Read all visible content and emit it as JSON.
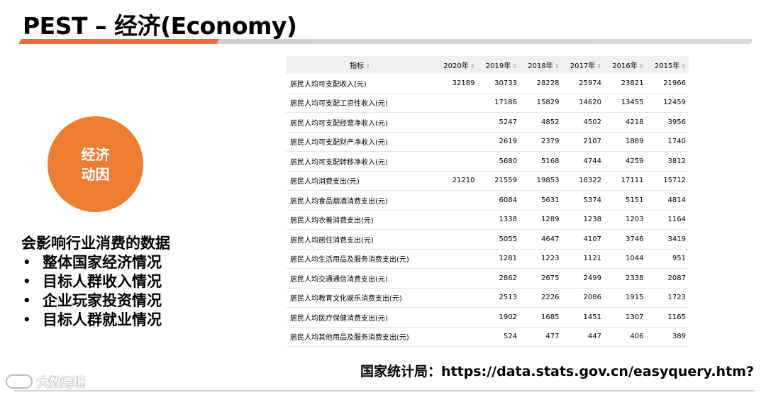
{
  "slide": {
    "title": "PEST – 经济(Economy)"
  },
  "circle": {
    "line1": "经济",
    "line2": "动因"
  },
  "factors": {
    "heading": "会影响行业消费的数据",
    "items": [
      "整体国家经济情况",
      "目标人群收入情况",
      "企业玩家投资情况",
      "目标人群就业情况"
    ]
  },
  "table": {
    "headers": [
      "指标",
      "2020年",
      "2019年",
      "2018年",
      "2017年",
      "2016年",
      "2015年"
    ],
    "sort_icon": "⇕",
    "rows": [
      [
        "居民人均可支配收入(元)",
        "32189",
        "30733",
        "28228",
        "25974",
        "23821",
        "21966"
      ],
      [
        "居民人均可支配工资性收入(元)",
        "",
        "17186",
        "15829",
        "14620",
        "13455",
        "12459"
      ],
      [
        "居民人均可支配经营净收入(元)",
        "",
        "5247",
        "4852",
        "4502",
        "4218",
        "3956"
      ],
      [
        "居民人均可支配财产净收入(元)",
        "",
        "2619",
        "2379",
        "2107",
        "1889",
        "1740"
      ],
      [
        "居民人均可支配转移净收入(元)",
        "",
        "5680",
        "5168",
        "4744",
        "4259",
        "3812"
      ],
      [
        "居民人均消费支出(元)",
        "21210",
        "21559",
        "19853",
        "18322",
        "17111",
        "15712"
      ],
      [
        "居民人均食品烟酒消费支出(元)",
        "",
        "6084",
        "5631",
        "5374",
        "5151",
        "4814"
      ],
      [
        "居民人均衣着消费支出(元)",
        "",
        "1338",
        "1289",
        "1238",
        "1203",
        "1164"
      ],
      [
        "居民人均居住消费支出(元)",
        "",
        "5055",
        "4647",
        "4107",
        "3746",
        "3419"
      ],
      [
        "居民人均生活用品及服务消费支出(元)",
        "",
        "1281",
        "1223",
        "1121",
        "1044",
        "951"
      ],
      [
        "居民人均交通通信消费支出(元)",
        "",
        "2862",
        "2675",
        "2499",
        "2338",
        "2087"
      ],
      [
        "居民人均教育文化娱乐消费支出(元)",
        "",
        "2513",
        "2226",
        "2086",
        "1915",
        "1723"
      ],
      [
        "居民人均医疗保健消费支出(元)",
        "",
        "1902",
        "1685",
        "1451",
        "1307",
        "1165"
      ],
      [
        "居民人均其他用品及服务消费支出(元)",
        "",
        "524",
        "477",
        "447",
        "406",
        "389"
      ]
    ]
  },
  "source": {
    "label": "国家统计局：",
    "url": "https://data.stats.gov.cn/easyquery.htm?"
  },
  "watermark": {
    "text": "大数跨境"
  }
}
